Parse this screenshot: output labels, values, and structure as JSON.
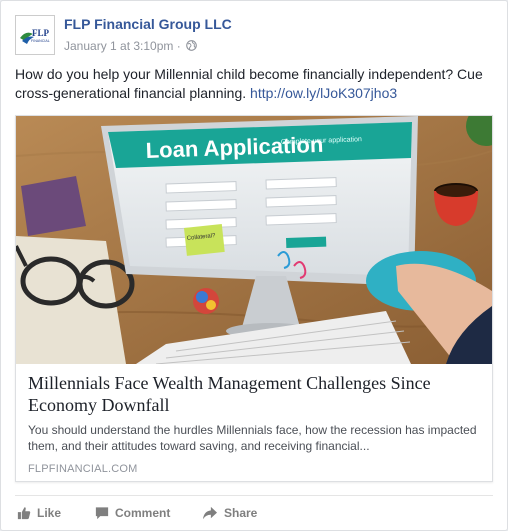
{
  "post": {
    "page_name": "FLP Financial Group LLC",
    "timestamp": "January 1 at 3:10pm",
    "separator": " · ",
    "avatar_text": "FLP",
    "avatar_subtext": "FINANCIAL",
    "text": "How do you help your Millennial child become financially independent? Cue cross-generational financial planning.",
    "link_url": "http://ow.ly/lJoK307jho3"
  },
  "link_preview": {
    "image_banner": "Loan Application",
    "image_subbanner": "Complete your application",
    "image_sticky": "Collateral?",
    "title": "Millennials Face Wealth Management Challenges Since Economy Downfall",
    "description": "You should understand the hurdles Millennials face, how the recession has impacted them, and their attitudes toward saving, and receiving financial...",
    "domain": "FLPFINANCIAL.COM"
  },
  "actions": {
    "like": "Like",
    "comment": "Comment",
    "share": "Share"
  },
  "colors": {
    "link": "#365899",
    "meta": "#90949c",
    "action": "#7f7f7f"
  }
}
